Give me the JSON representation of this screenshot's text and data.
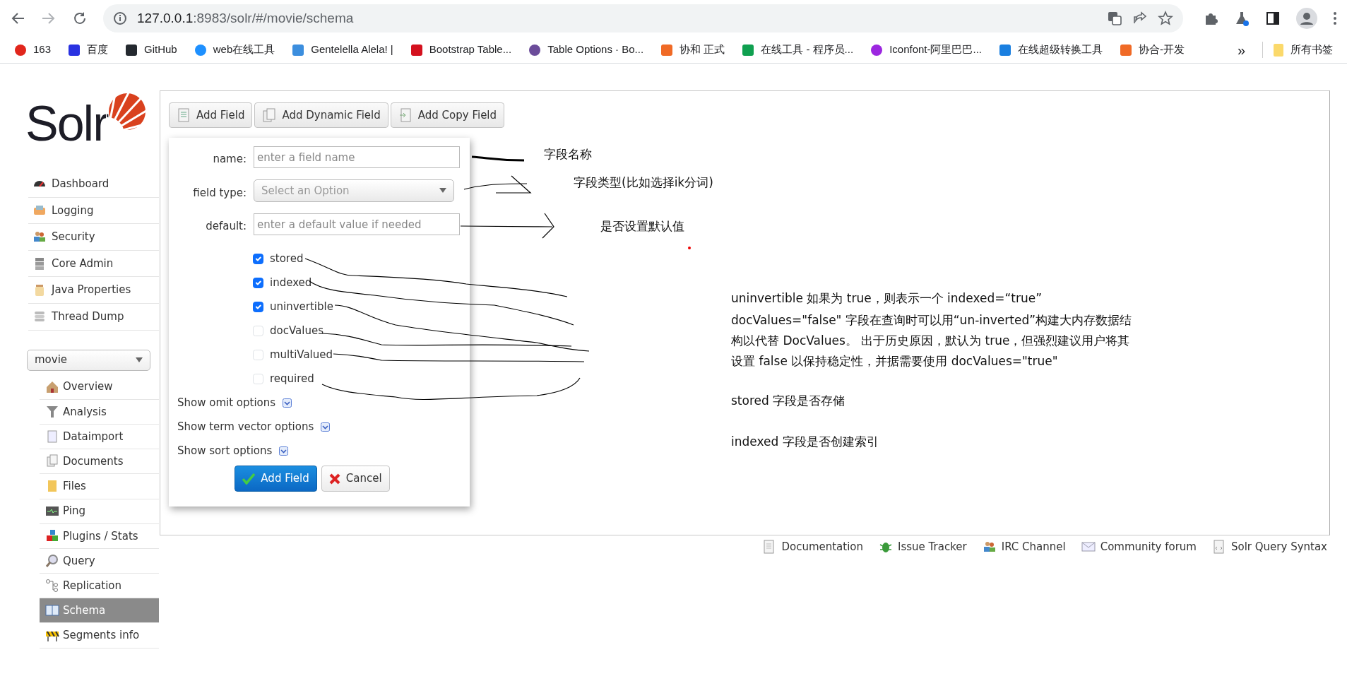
{
  "browser": {
    "address": {
      "host": "127.0.0.1",
      "path": ":8983/solr/#/movie/schema"
    },
    "bookmarks": [
      {
        "label": "163"
      },
      {
        "label": "百度"
      },
      {
        "label": "GitHub"
      },
      {
        "label": "web在线工具"
      },
      {
        "label": "Gentelella Alela! |"
      },
      {
        "label": "Bootstrap Table..."
      },
      {
        "label": "Table Options · Bo..."
      },
      {
        "label": "协和 正式"
      },
      {
        "label": "在线工具 - 程序员..."
      },
      {
        "label": "Iconfont-阿里巴巴..."
      },
      {
        "label": "在线超级转换工具"
      },
      {
        "label": "协合-开发"
      }
    ],
    "overflow": "»",
    "all_bookmarks": "所有书签"
  },
  "logo": "Solr",
  "sidebar": {
    "items": [
      {
        "label": "Dashboard"
      },
      {
        "label": "Logging"
      },
      {
        "label": "Security"
      },
      {
        "label": "Core Admin"
      },
      {
        "label": "Java Properties"
      },
      {
        "label": "Thread Dump"
      }
    ],
    "core_select": {
      "value": "movie"
    },
    "core_items": [
      {
        "label": "Overview",
        "selected": false
      },
      {
        "label": "Analysis",
        "selected": false
      },
      {
        "label": "Dataimport",
        "selected": false
      },
      {
        "label": "Documents",
        "selected": false
      },
      {
        "label": "Files",
        "selected": false
      },
      {
        "label": "Ping",
        "selected": false
      },
      {
        "label": "Plugins / Stats",
        "selected": false
      },
      {
        "label": "Query",
        "selected": false
      },
      {
        "label": "Replication",
        "selected": false
      },
      {
        "label": "Schema",
        "selected": true
      },
      {
        "label": "Segments info",
        "selected": false
      }
    ]
  },
  "toolbar": [
    "Add Field",
    "Add Dynamic Field",
    "Add Copy Field"
  ],
  "form": {
    "fields": [
      {
        "label": "name:",
        "kind": "text",
        "placeholder": "enter a field name"
      },
      {
        "label": "field type:",
        "kind": "select",
        "value": "Select an Option"
      },
      {
        "label": "default:",
        "kind": "text",
        "placeholder": "enter a default value if needed"
      }
    ],
    "checkboxes": [
      {
        "label": "stored",
        "checked": true
      },
      {
        "label": "indexed",
        "checked": true
      },
      {
        "label": "uninvertible",
        "checked": true
      },
      {
        "label": "docValues",
        "checked": false
      },
      {
        "label": "multiValued",
        "checked": false
      },
      {
        "label": "required",
        "checked": false
      }
    ],
    "toggles": [
      "Show omit options",
      "Show term vector options",
      "Show sort options"
    ],
    "submit": "Add Field",
    "cancel": "Cancel"
  },
  "annotations": [
    "字段名称",
    "字段类型(比如选择ik分词)",
    "是否设置默认值",
    "uninvertible 如果为 true，则表示一个 indexed=“true”",
    "docValues=\"false\" 字段在查询时可以用“un-inverted”构建大内存数据结构以代替 DocValues。 出于历史原因，默认为 true，但强烈建议用户将其设置 false 以保持稳定性，并据需要使用 docValues=\"true\"",
    "stored 字段是否存储",
    "indexed 字段是否创建索引"
  ],
  "footer": [
    "Documentation",
    "Issue Tracker",
    "IRC Channel",
    "Community forum",
    "Solr Query Syntax"
  ]
}
